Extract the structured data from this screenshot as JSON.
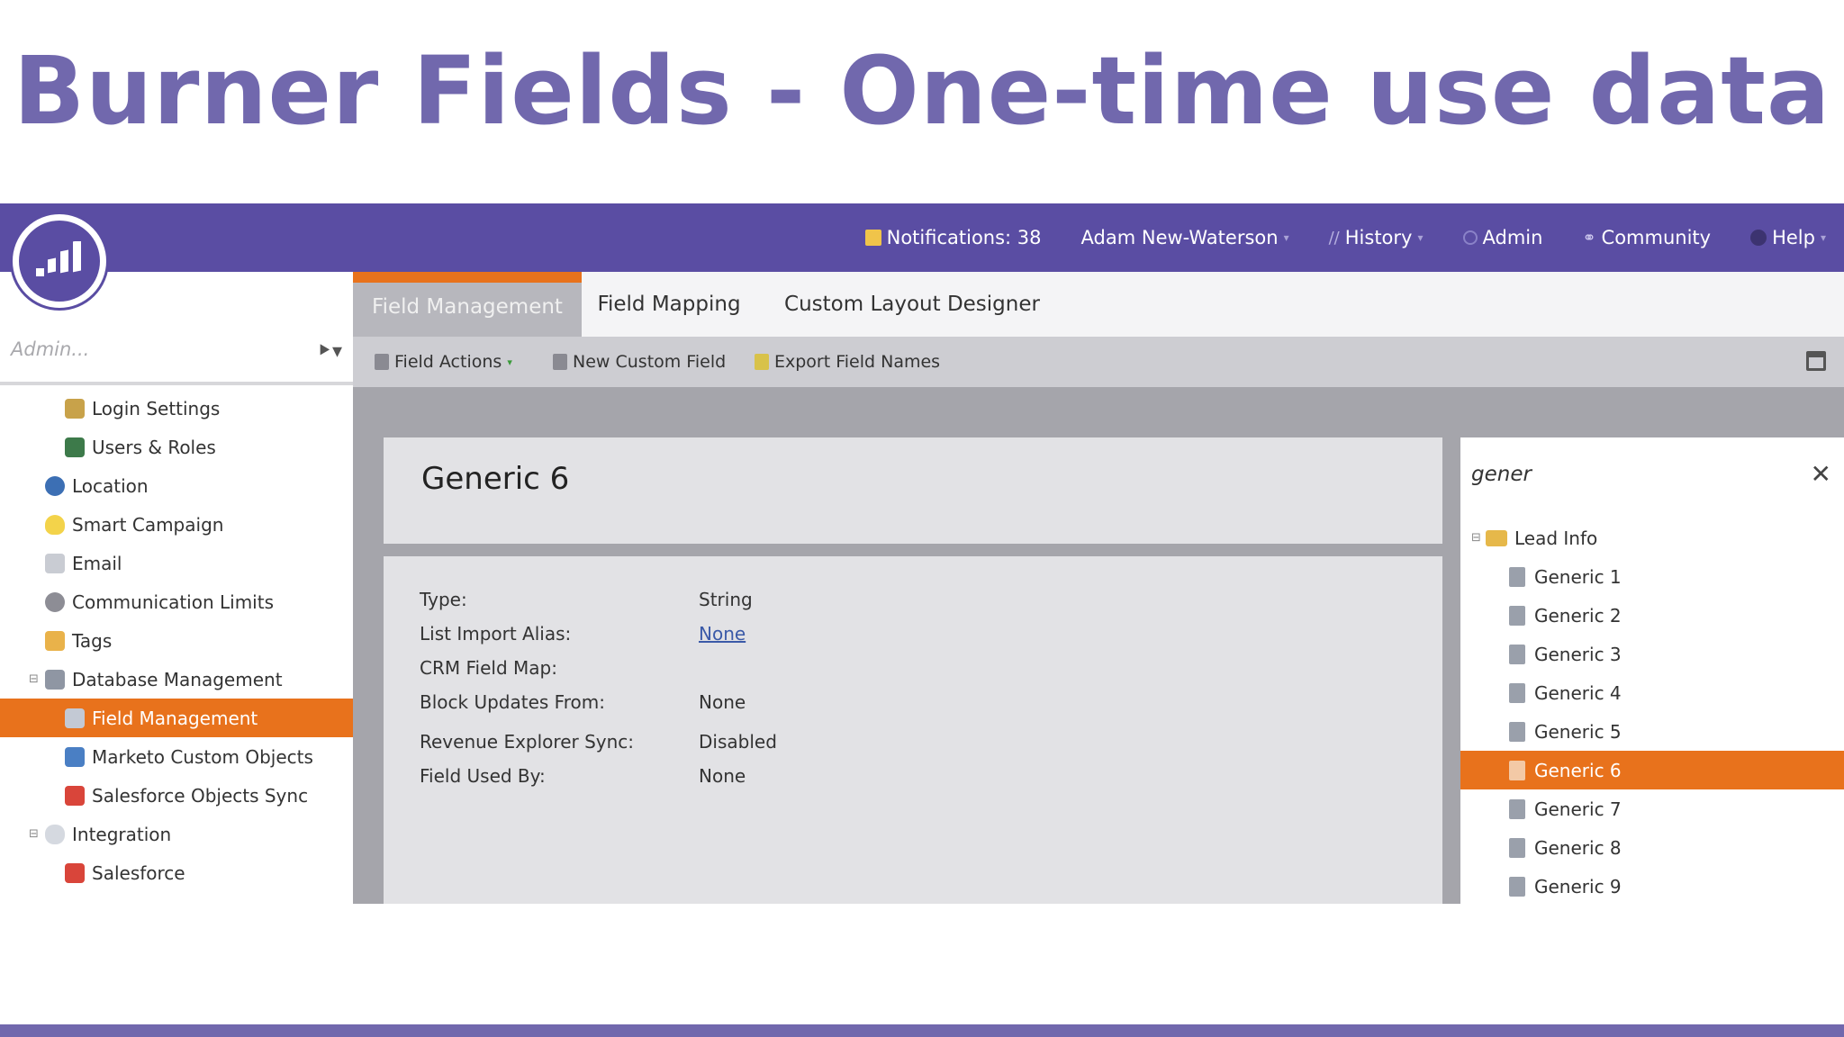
{
  "slide": {
    "title": "Burner Fields - One-time use data"
  },
  "topbar": {
    "notifications": "Notifications: 38",
    "user": "Adam New-Waterson",
    "history": "History",
    "admin": "Admin",
    "community": "Community",
    "help": "Help"
  },
  "sidebar": {
    "search_placeholder": "Admin...",
    "items": [
      {
        "label": "Login Settings"
      },
      {
        "label": "Users & Roles"
      },
      {
        "label": "Location"
      },
      {
        "label": "Smart Campaign"
      },
      {
        "label": "Email"
      },
      {
        "label": "Communication Limits"
      },
      {
        "label": "Tags"
      },
      {
        "label": "Database Management"
      },
      {
        "label": "Field Management"
      },
      {
        "label": "Marketo Custom Objects"
      },
      {
        "label": "Salesforce Objects Sync"
      },
      {
        "label": "Integration"
      },
      {
        "label": "Salesforce"
      }
    ]
  },
  "tabs": [
    {
      "label": "Field Management"
    },
    {
      "label": "Field Mapping"
    },
    {
      "label": "Custom Layout Designer"
    }
  ],
  "toolbar": {
    "field_actions": "Field Actions",
    "new_custom_field": "New Custom Field",
    "export_field_names": "Export Field Names"
  },
  "detail": {
    "title": "Generic 6",
    "properties": [
      {
        "label": "Type:",
        "value": "String"
      },
      {
        "label": "List Import Alias:",
        "value": "None"
      },
      {
        "label": "CRM Field Map:",
        "value": ""
      },
      {
        "label": "Block Updates From:",
        "value": "None"
      },
      {
        "label": "Revenue Explorer Sync:",
        "value": "Disabled"
      },
      {
        "label": "Field Used By:",
        "value": "None"
      }
    ]
  },
  "field_list": {
    "search_value": "gener",
    "folder": "Lead Info",
    "items": [
      {
        "label": "Generic 1"
      },
      {
        "label": "Generic 2"
      },
      {
        "label": "Generic 3"
      },
      {
        "label": "Generic 4"
      },
      {
        "label": "Generic 5"
      },
      {
        "label": "Generic 6"
      },
      {
        "label": "Generic 7"
      },
      {
        "label": "Generic 8"
      },
      {
        "label": "Generic 9"
      }
    ]
  },
  "colors": {
    "title": "#7168ad",
    "topbar": "#5a4da3",
    "accent": "#e8721c"
  }
}
